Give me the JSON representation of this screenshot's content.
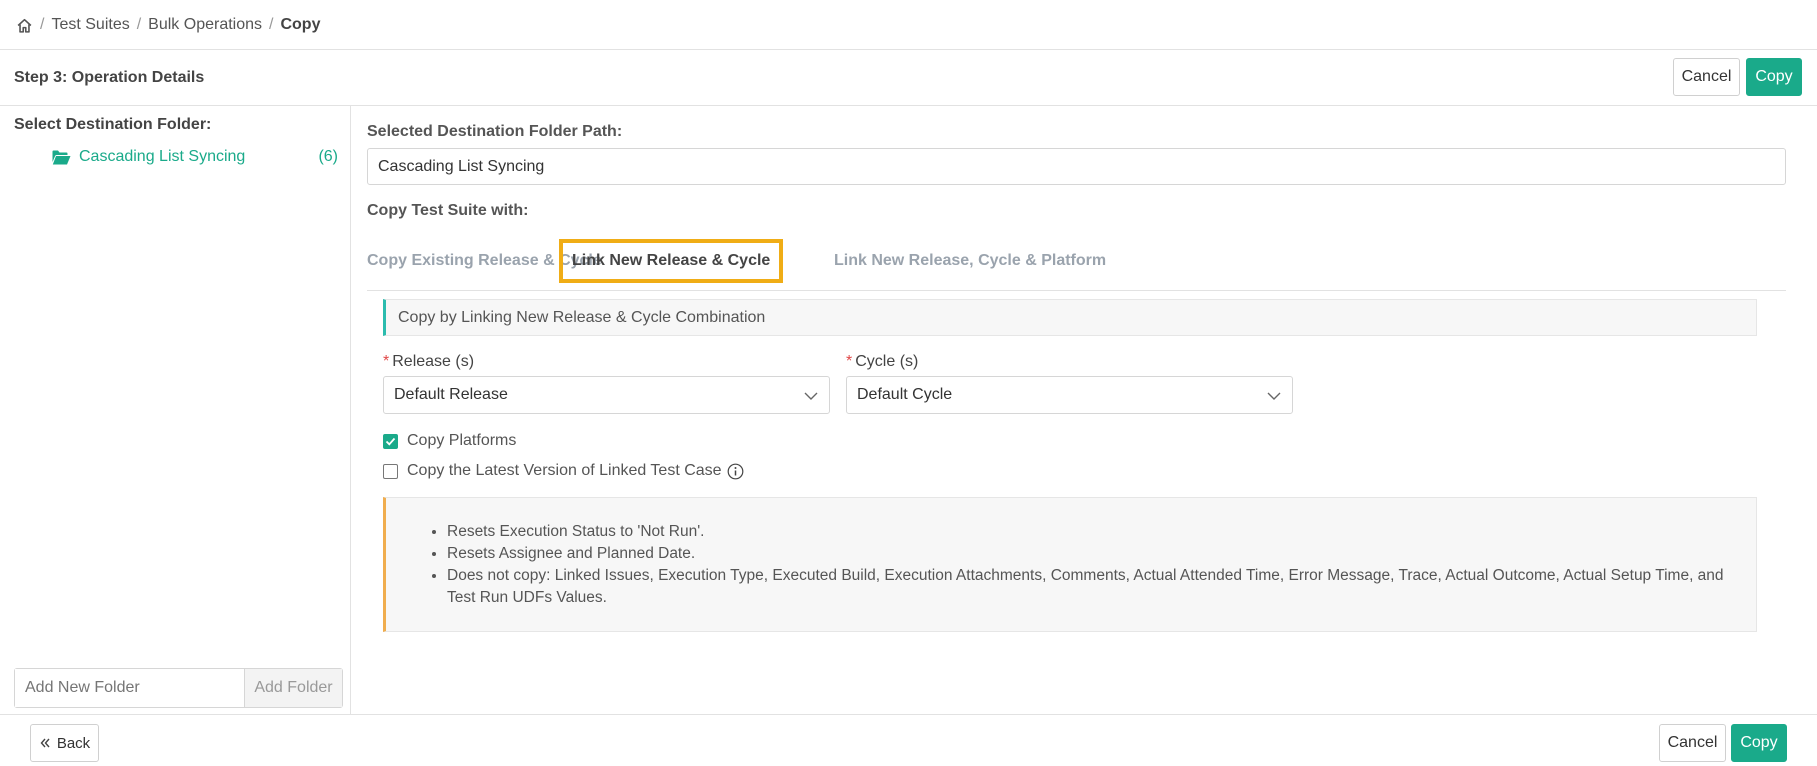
{
  "breadcrumb": {
    "home_icon": "home-icon",
    "items": [
      "Test Suites",
      "Bulk Operations"
    ],
    "current": "Copy"
  },
  "header": {
    "step_title": "Step 3: Operation Details",
    "cancel_label": "Cancel",
    "copy_label": "Copy"
  },
  "left_panel": {
    "title": "Select Destination Folder:",
    "folder": {
      "icon": "folder-open-icon",
      "name": "Cascading List Syncing",
      "count": "(6)"
    },
    "add_folder_placeholder": "Add New Folder",
    "add_folder_button": "Add Folder"
  },
  "main": {
    "path_label": "Selected Destination Folder Path:",
    "path_value": "Cascading List Syncing",
    "copy_with_label": "Copy Test Suite with:",
    "tabs": [
      {
        "label": "Copy Existing Release & Cycle",
        "active": false
      },
      {
        "label": "Link New Release & Cycle",
        "active": true
      },
      {
        "label": "Link New Release, Cycle & Platform",
        "active": false
      }
    ],
    "info_text": "Copy by Linking New Release & Cycle Combination",
    "release": {
      "required_mark": "*",
      "label": "Release (s)",
      "value": "Default Release"
    },
    "cycle": {
      "required_mark": "*",
      "label": "Cycle (s)",
      "value": "Default Cycle"
    },
    "copy_platforms": {
      "label": "Copy Platforms",
      "checked": true
    },
    "copy_latest": {
      "label": "Copy the Latest Version of Linked Test Case",
      "checked": false,
      "icon": "info-icon"
    },
    "notes": [
      "Resets Execution Status to 'Not Run'.",
      "Resets Assignee and Planned Date.",
      "Does not copy: Linked Issues, Execution Type, Executed Build, Execution Attachments, Comments, Actual Attended Time, Error Message, Trace, Actual Outcome, Actual Setup Time, and Test Run UDFs Values."
    ]
  },
  "footer": {
    "back_label": "Back",
    "back_icon": "double-chevron-left-icon",
    "cancel_label": "Cancel",
    "copy_label": "Copy"
  },
  "colors": {
    "primary": "#1aaa8a",
    "tab_highlight": "#f0ad16",
    "info_accent": "#2bbcae",
    "note_accent": "#f0ad4e",
    "required": "#e04848"
  }
}
